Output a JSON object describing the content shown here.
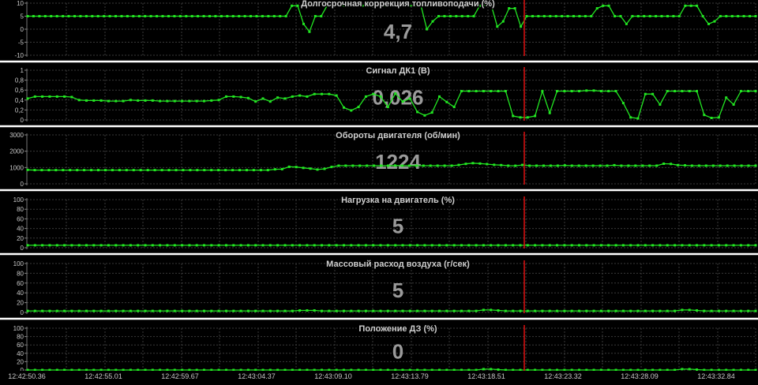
{
  "chart_data": [
    {
      "type": "line",
      "title": "Долгосрочная коррекция топливоподачи  (%)",
      "value": "4,7",
      "ylim": [
        -10,
        10
      ],
      "yticks": [
        "10",
        "5",
        "0",
        "-5",
        "-10"
      ],
      "series": [
        {
          "values": [
            5,
            5,
            5,
            5,
            5,
            5,
            5,
            5,
            5,
            5,
            5,
            5,
            5,
            5,
            5,
            5,
            5,
            5,
            5,
            5,
            5,
            5,
            5,
            5,
            5,
            5,
            5,
            5,
            5,
            5,
            5,
            5,
            5,
            5,
            5,
            5,
            5,
            5,
            5,
            5,
            5,
            5,
            5,
            5,
            5,
            9,
            9,
            2,
            -1,
            5,
            5,
            9,
            9,
            9,
            9,
            9,
            9,
            9,
            9,
            9,
            9,
            9,
            9,
            9,
            9,
            9,
            9,
            9,
            0,
            3,
            5,
            5,
            5,
            5,
            5,
            5,
            5,
            9,
            9,
            9,
            1,
            3,
            8,
            8,
            1,
            5,
            5,
            5,
            5,
            5,
            5,
            5,
            5,
            5,
            5,
            5,
            5,
            8,
            9,
            9,
            5,
            5,
            2,
            5,
            5,
            5,
            5,
            5,
            5,
            5,
            5,
            5,
            9,
            9,
            9,
            5,
            2,
            3,
            5,
            5,
            5,
            5,
            5,
            5,
            5
          ]
        }
      ]
    },
    {
      "type": "line",
      "title": "Сигнал ДК1  (В)",
      "value": "0,026",
      "ylim": [
        0,
        1
      ],
      "yticks": [
        "1",
        "0,8",
        "0,6",
        "0,4",
        "0,2",
        "0"
      ],
      "series": [
        {
          "values": [
            0.43,
            0.47,
            0.47,
            0.47,
            0.47,
            0.47,
            0.46,
            0.4,
            0.39,
            0.39,
            0.39,
            0.38,
            0.38,
            0.38,
            0.4,
            0.39,
            0.39,
            0.39,
            0.38,
            0.38,
            0.38,
            0.38,
            0.38,
            0.38,
            0.38,
            0.39,
            0.4,
            0.47,
            0.47,
            0.46,
            0.44,
            0.37,
            0.43,
            0.37,
            0.45,
            0.43,
            0.47,
            0.49,
            0.47,
            0.52,
            0.52,
            0.52,
            0.49,
            0.25,
            0.19,
            0.26,
            0.47,
            0.52,
            0.47,
            0.26,
            0.53,
            0.37,
            0.43,
            0.16,
            0.09,
            0.15,
            0.47,
            0.36,
            0.26,
            0.58,
            0.58,
            0.58,
            0.58,
            0.58,
            0.58,
            0.58,
            0.08,
            0.05,
            0.05,
            0.08,
            0.58,
            0.14,
            0.58,
            0.58,
            0.58,
            0.58,
            0.59,
            0.59,
            0.58,
            0.58,
            0.58,
            0.34,
            0.05,
            0.03,
            0.52,
            0.52,
            0.31,
            0.58,
            0.58,
            0.58,
            0.58,
            0.58,
            0.1,
            0.04,
            0.05,
            0.45,
            0.31,
            0.58,
            0.58,
            0.58
          ]
        }
      ]
    },
    {
      "type": "line",
      "title": "Обороты двигателя   (об/мин)",
      "value": "1224",
      "ylim": [
        0,
        3500
      ],
      "yticks": [
        "3000",
        "2000",
        "1000",
        "0"
      ],
      "series": [
        {
          "values": [
            1000,
            980,
            980,
            980,
            980,
            980,
            980,
            980,
            980,
            980,
            980,
            980,
            980,
            980,
            980,
            980,
            980,
            980,
            980,
            980,
            980,
            980,
            980,
            980,
            980,
            980,
            980,
            980,
            980,
            980,
            980,
            980,
            980,
            980,
            980,
            1040,
            1050,
            1220,
            1200,
            1140,
            1090,
            1020,
            1070,
            1210,
            1300,
            1300,
            1300,
            1300,
            1300,
            1300,
            1300,
            1300,
            1310,
            1300,
            1300,
            1300,
            1300,
            1300,
            1300,
            1300,
            1300,
            1350,
            1430,
            1480,
            1450,
            1410,
            1360,
            1340,
            1300,
            1290,
            1350,
            1300,
            1300,
            1300,
            1300,
            1300,
            1320,
            1300,
            1300,
            1300,
            1300,
            1300,
            1300,
            1330,
            1300,
            1300,
            1300,
            1300,
            1300,
            1300,
            1440,
            1420,
            1340,
            1320,
            1300,
            1300,
            1300,
            1300,
            1300,
            1300,
            1300,
            1300,
            1300,
            1300
          ]
        }
      ]
    },
    {
      "type": "line",
      "title": "Нагрузка на двигатель  (%)",
      "value": "5",
      "ylim": [
        0,
        100
      ],
      "yticks": [
        "100",
        "80",
        "60",
        "40",
        "20",
        "0"
      ],
      "series": [
        {
          "values": [
            5,
            5,
            5,
            5,
            5,
            5,
            5,
            5,
            5,
            5,
            5,
            5,
            5,
            5,
            5,
            5,
            5,
            5,
            5,
            5,
            5,
            5,
            5,
            5,
            5,
            5,
            5,
            5,
            5,
            5,
            5,
            5,
            5,
            5,
            5,
            5,
            5,
            5,
            5,
            5,
            5,
            5,
            5,
            5,
            5,
            5,
            5,
            5,
            5,
            5,
            5,
            5,
            5,
            5,
            5,
            5,
            5,
            5,
            5,
            5,
            5,
            5,
            5,
            5,
            5,
            5,
            5,
            5,
            5,
            5,
            5,
            5,
            5,
            5,
            5,
            5,
            5,
            5,
            5,
            5,
            5,
            5,
            5,
            5,
            5,
            5,
            5,
            5,
            5,
            5,
            5,
            5,
            5,
            5,
            5,
            5,
            5,
            5,
            5,
            5
          ]
        }
      ]
    },
    {
      "type": "line",
      "title": "Массовый расход воздуха  (г/сек)",
      "value": "5",
      "ylim": [
        0,
        100
      ],
      "yticks": [
        "100",
        "80",
        "60",
        "40",
        "20",
        "0"
      ],
      "series": [
        {
          "values": [
            3,
            3,
            3,
            3,
            3,
            3,
            3,
            3,
            3,
            3,
            3,
            3,
            3,
            3,
            3,
            3,
            3,
            3,
            3,
            3,
            3,
            3,
            3,
            3,
            3,
            3,
            3,
            3,
            3,
            3,
            3,
            3,
            3,
            3,
            3,
            3,
            3,
            4,
            4,
            4,
            3,
            3,
            3,
            3,
            3,
            3,
            3,
            3,
            3,
            3,
            3,
            3,
            3,
            3,
            3,
            3,
            3,
            3,
            3,
            3,
            3,
            3,
            5,
            5,
            4,
            3,
            3,
            3,
            3,
            3,
            3,
            3,
            3,
            3,
            3,
            3,
            3,
            3,
            3,
            3,
            3,
            3,
            3,
            3,
            3,
            3,
            3,
            3,
            3,
            5,
            5,
            4,
            3,
            3,
            3,
            3,
            3,
            3,
            3,
            3
          ]
        }
      ]
    },
    {
      "type": "line",
      "title": "Положение ДЗ  (%)",
      "value": "0",
      "ylim": [
        0,
        100
      ],
      "yticks": [
        "100",
        "80",
        "60",
        "40",
        "20",
        "0"
      ],
      "series": [
        {
          "values": [
            0,
            0,
            0,
            0,
            0,
            0,
            0,
            0,
            0,
            0,
            0,
            0,
            0,
            0,
            0,
            0,
            0,
            0,
            0,
            0,
            0,
            0,
            0,
            0,
            0,
            0,
            0,
            0,
            0,
            0,
            0,
            0,
            0,
            0,
            0,
            0,
            0,
            0,
            0,
            0,
            0,
            0,
            0,
            0,
            0,
            0,
            0,
            0,
            0,
            0,
            0,
            0,
            0,
            0,
            0,
            0,
            0,
            0,
            0,
            0,
            0,
            0,
            2,
            2,
            1,
            0,
            0,
            0,
            0,
            0,
            0,
            0,
            0,
            0,
            0,
            0,
            0,
            0,
            0,
            0,
            0,
            0,
            0,
            0,
            0,
            0,
            0,
            0,
            0,
            2,
            2,
            1,
            0,
            0,
            0,
            0,
            0,
            0,
            0,
            0
          ]
        }
      ]
    }
  ],
  "x_labels": [
    "12:42:50.36",
    "12:42:55.01",
    "12:42:59.67",
    "12:43:04.37",
    "12:43:09.10",
    "12:43:13.79",
    "12:43:18.51",
    "12:43:23.32",
    "12:43:28.09",
    "12:43:32.84"
  ],
  "colors": {
    "background": "#000000",
    "line": "#22e622",
    "grid": "#3a3a3a",
    "cursor": "#dd1111",
    "separator": "#ffffff",
    "text": "#c8c8c8",
    "value": "#9a9a9a"
  }
}
